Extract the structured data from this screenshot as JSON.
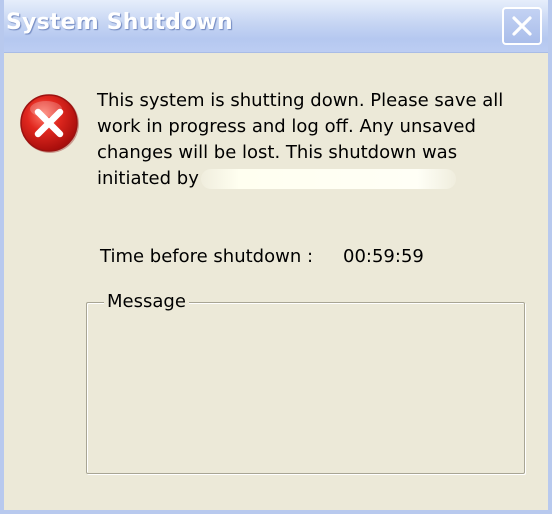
{
  "window": {
    "title": "System Shutdown"
  },
  "icons": {
    "error": "error-icon",
    "close": "close-icon"
  },
  "message": {
    "lines": [
      "This system is shutting down. Please save all",
      "work in progress and log off. Any unsaved",
      "changes will be lost. This shutdown was",
      "initiated by"
    ]
  },
  "timer": {
    "label": "Time before shutdown :",
    "value": "00:59:59"
  },
  "message_group": {
    "label": "Message",
    "content": ""
  },
  "colors": {
    "dialog_background": "#ECE9D8",
    "titlebar": "#C6D5F3",
    "error_red": "#D8201C"
  }
}
